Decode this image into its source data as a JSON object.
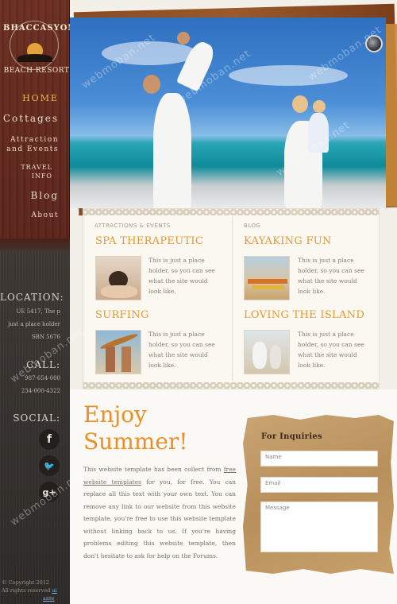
{
  "logo": {
    "arc_text": "BHACCASYONZTAS",
    "subtitle": "BEACH RESORT"
  },
  "nav": [
    {
      "label": "HOME",
      "active": true
    },
    {
      "label": "Cottages"
    },
    {
      "label": "Attraction and Events"
    },
    {
      "label": "TRAVEL INFO"
    },
    {
      "label": "Blog"
    },
    {
      "label": "About"
    }
  ],
  "location": {
    "heading": "LOCATION:",
    "line1": "UE 5417, The p",
    "line2": "just a place holder",
    "line3": "SBN 5676"
  },
  "call": {
    "heading": "CALL:",
    "line1": "987-654-000",
    "line2": "234-000-4322"
  },
  "social": {
    "heading": "SOCIAL:",
    "icons": [
      "facebook-icon",
      "twitter-icon",
      "google-plus-icon"
    ],
    "f": "f",
    "g": "g+"
  },
  "copyright": {
    "line1": "© Copyright 2012",
    "line2": "All rights reserved",
    "link": "ui",
    "link2": "ante"
  },
  "panel": {
    "left_category": "ATTRACTIONS & EVENTS",
    "right_category": "BLOG",
    "items": [
      {
        "title": "SPA THERAPEUTIC",
        "text": "This is just a place holder, so you can see what the site would look like."
      },
      {
        "title": "KAYAKING FUN",
        "text": "This is just a place holder, so you can see what the site would look like."
      },
      {
        "title": "SURFING",
        "text": "This is just a place holder, so you can see what the site would look like."
      },
      {
        "title": "LOVING THE ISLAND",
        "text": "This is just a place holder, so you can see what the site would look like."
      }
    ]
  },
  "enjoy": {
    "line1": "Enjoy",
    "line2": "Summer!"
  },
  "body_text": {
    "p1": "This website template has been collect from ",
    "link": "free website templates",
    "p2": " for you, for free. You can replace all this text with your own text. You can remove any link to our website from this website template, you're free to use this website template without linking back to us. If you're having problems editing this website template, then don't hesitate to ask for help on the Forums."
  },
  "form": {
    "title": "For Inquiries",
    "name_placeholder": "Name",
    "email_placeholder": "Email",
    "message_placeholder": "Message"
  },
  "watermark": "webmoban.net",
  "colors": {
    "accent": "#e49a34",
    "nav_active": "#f1b74a",
    "sidebar": "#5a241a"
  }
}
